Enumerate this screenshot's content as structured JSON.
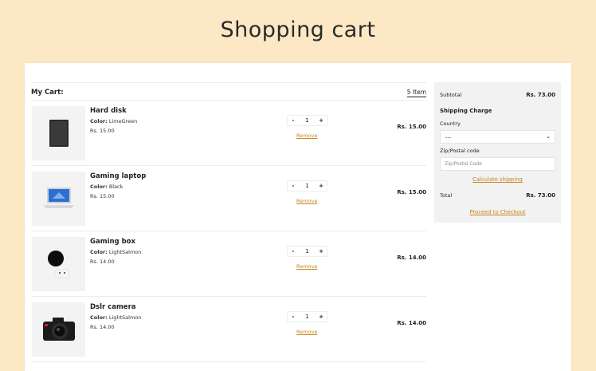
{
  "page": {
    "title": "Shopping cart"
  },
  "cart": {
    "label": "My Cart:",
    "count": "5 Item",
    "items": [
      {
        "name": "Hard disk",
        "color_label": "Color:",
        "color": "LimeGreen",
        "price": "Rs. 15.00",
        "qty": "1",
        "remove": "Remove",
        "total": "Rs. 15.00",
        "image": "hard-disk"
      },
      {
        "name": "Gaming laptop",
        "color_label": "Color:",
        "color": "Black",
        "price": "Rs. 15.00",
        "qty": "1",
        "remove": "Remove",
        "total": "Rs. 15.00",
        "image": "laptop"
      },
      {
        "name": "Gaming box",
        "color_label": "Color:",
        "color": "LightSalmon",
        "price": "Rs. 14.00",
        "qty": "1",
        "remove": "Remove",
        "total": "Rs. 14.00",
        "image": "console"
      },
      {
        "name": "Dslr camera",
        "color_label": "Color:",
        "color": "LightSalmon",
        "price": "Rs. 14.00",
        "qty": "1",
        "remove": "Remove",
        "total": "Rs. 14.00",
        "image": "camera"
      }
    ],
    "minus": "-",
    "plus": "+"
  },
  "summary": {
    "subtotal_label": "Subtotal",
    "subtotal": "Rs. 73.00",
    "shipping_heading": "Shipping Charge",
    "country_label": "Country",
    "country_value": "---",
    "zip_label": "Zip/Postal code",
    "zip_placeholder": "Zip/Postal Code",
    "calc_shipping": "Calculate shipping",
    "total_label": "Total",
    "total": "Rs. 73.00",
    "checkout": "Proceed to Checkout"
  },
  "colors": {
    "page_bg": "#fde8c6",
    "accent": "#c8841c"
  }
}
